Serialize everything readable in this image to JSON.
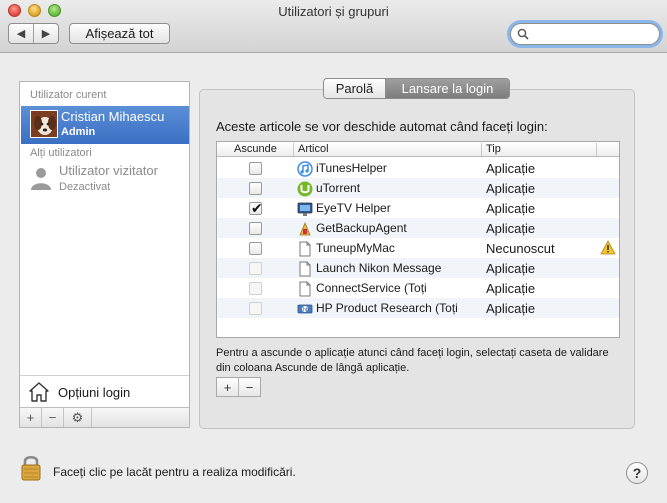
{
  "window": {
    "title": "Utilizatori și grupuri"
  },
  "toolbar": {
    "back_label": "◀",
    "forward_label": "▶",
    "show_all_label": "Afișează tot",
    "search_value": "",
    "search_placeholder": ""
  },
  "sidebar": {
    "current_user_header": "Utilizator curent",
    "current_user": {
      "name": "Cristian Mihaescu",
      "role": "Admin"
    },
    "other_users_header": "Alți utilizatori",
    "guest": {
      "name": "Utilizator vizitator",
      "state": "Dezactivat"
    },
    "login_options_label": "Opțiuni login",
    "add_label": "+",
    "remove_label": "−",
    "gear_label": "⚙"
  },
  "tabs": [
    {
      "label": "Parolă",
      "selected": false
    },
    {
      "label": "Lansare la login",
      "selected": true
    }
  ],
  "main": {
    "intro": "Aceste articole se vor deschide automat când faceți login:",
    "columns": {
      "hide": "Ascunde",
      "item": "Articol",
      "type": "Tip"
    },
    "rows": [
      {
        "hidden": false,
        "enabled": true,
        "name": "iTunesHelper",
        "type": "Aplicație",
        "icon": "itunes-icon",
        "warning": false
      },
      {
        "hidden": false,
        "enabled": true,
        "name": "uTorrent",
        "type": "Aplicație",
        "icon": "utorrent-icon",
        "warning": false
      },
      {
        "hidden": true,
        "enabled": true,
        "name": "EyeTV Helper",
        "type": "Aplicație",
        "icon": "eyetv-icon",
        "warning": false
      },
      {
        "hidden": false,
        "enabled": true,
        "name": "GetBackupAgent",
        "type": "Aplicație",
        "icon": "getbackup-icon",
        "warning": false
      },
      {
        "hidden": false,
        "enabled": true,
        "name": "TuneupMyMac",
        "type": "Necunoscut",
        "icon": "document-icon",
        "warning": true
      },
      {
        "hidden": false,
        "enabled": false,
        "name": "Launch Nikon Message",
        "type": "Aplicație",
        "icon": "document-icon",
        "warning": false
      },
      {
        "hidden": false,
        "enabled": false,
        "name": "ConnectService (Toți",
        "type": "Aplicație",
        "icon": "document-icon",
        "warning": false
      },
      {
        "hidden": false,
        "enabled": false,
        "name": "HP Product Research (Toți",
        "type": "Aplicație",
        "icon": "hp-icon",
        "warning": false
      }
    ],
    "hint": "Pentru a ascunde o aplicație atunci când faceți login, selectați caseta de validare din coloana Ascunde de lângă aplicație.",
    "add_label": "+",
    "remove_label": "−"
  },
  "footer": {
    "lock_text": "Faceți clic pe lacăt pentru a realiza modificări.",
    "help_label": "?"
  },
  "colors": {
    "selection": "#3b6fc4",
    "focus_ring": "#8ab6e8"
  }
}
